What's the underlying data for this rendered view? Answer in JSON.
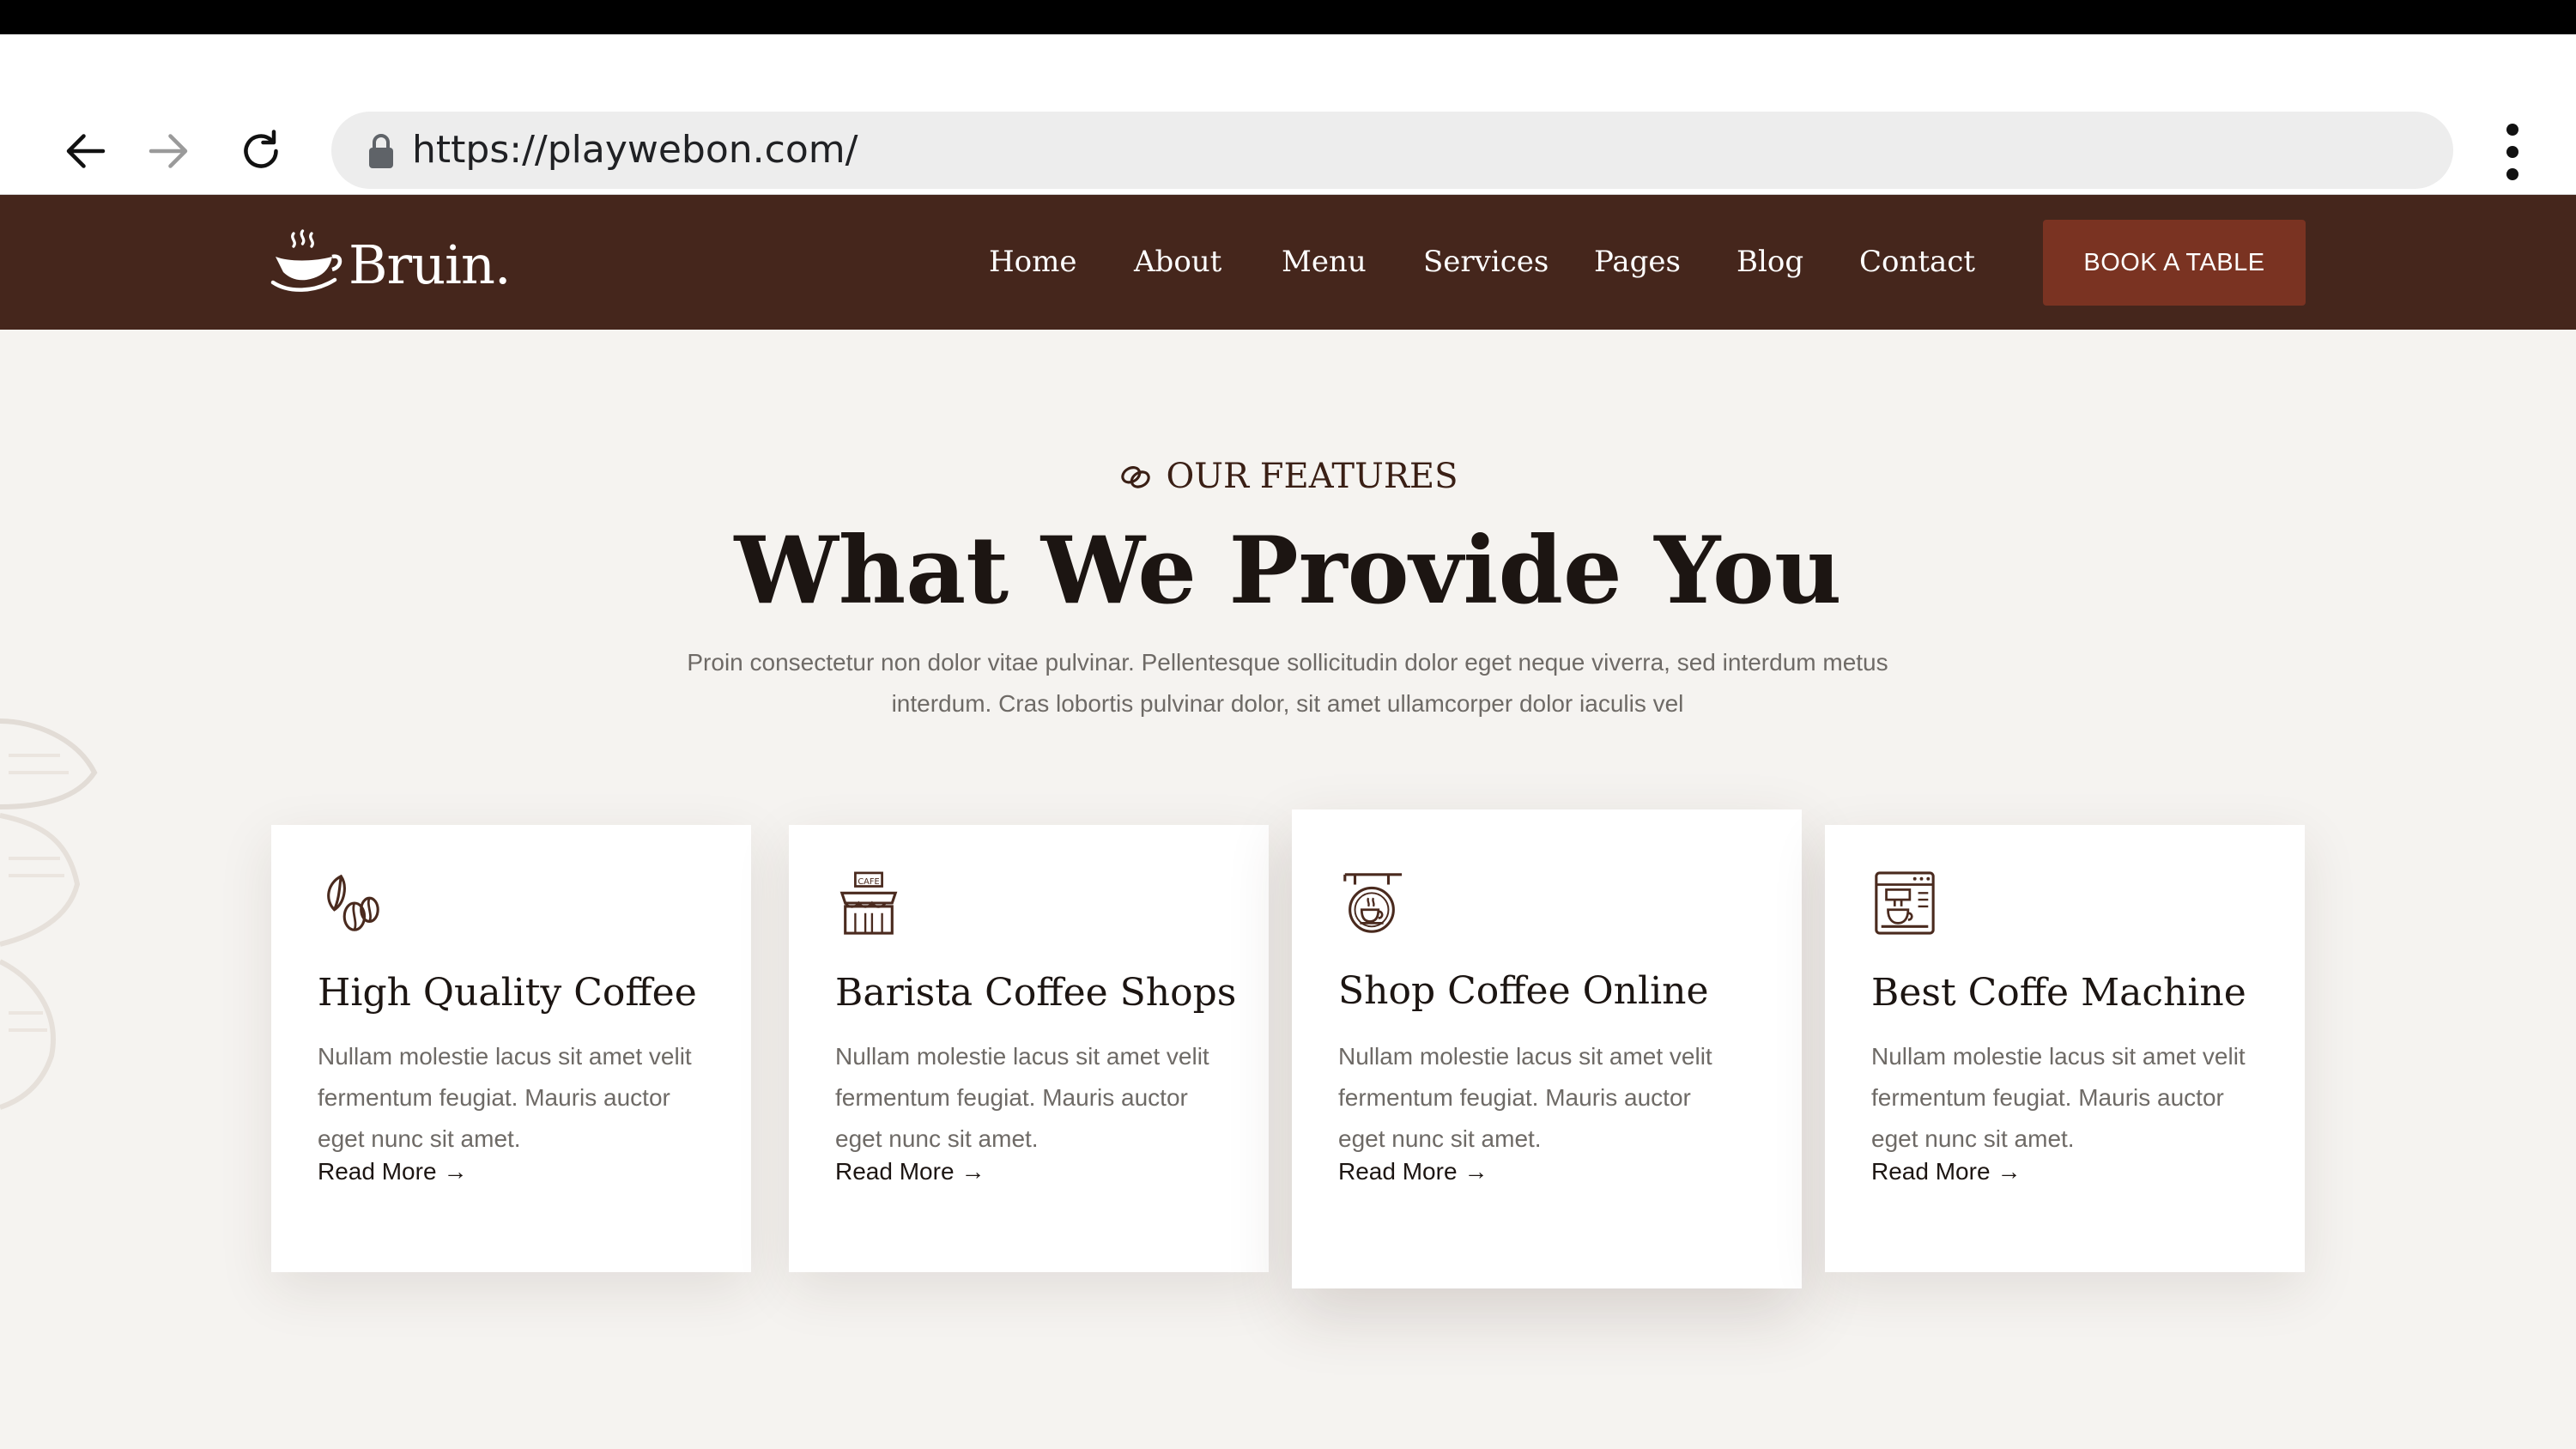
{
  "browser": {
    "url": "https://playwebon.com/",
    "icons": [
      "back-arrow-icon",
      "forward-arrow-icon",
      "reload-icon",
      "lock-icon",
      "more-vert-icon"
    ]
  },
  "header": {
    "logo_text": "Bruin.",
    "nav": [
      "Home",
      "About",
      "Menu",
      "Services",
      "Pages",
      "Blog",
      "Contact"
    ],
    "cta_label": "BOOK A TABLE",
    "colors": {
      "header_bg": "#45261c",
      "cta_bg": "#7a3322"
    }
  },
  "features": {
    "eyebrow": "OUR FEATURES",
    "title": "What We Provide You",
    "description": "Proin consectetur non dolor vitae pulvinar. Pellentesque sollicitudin dolor eget neque viverra, sed interdum metus interdum. Cras lobortis pulvinar dolor, sit amet ullamcorper dolor iaculis vel",
    "cards": [
      {
        "icon": "coffee-beans-icon",
        "title": "High Quality Coffee",
        "text": "Nullam molestie lacus sit amet velit fermentum feugiat. Mauris auctor eget nunc sit amet.",
        "link": "Read More"
      },
      {
        "icon": "cafe-shop-icon",
        "title": "Barista Coffee Shops",
        "text": "Nullam molestie lacus sit amet velit fermentum feugiat. Mauris auctor eget nunc sit amet.",
        "link": "Read More"
      },
      {
        "icon": "coffee-sign-icon",
        "title": "Shop Coffee Online",
        "text": "Nullam molestie lacus sit amet velit fermentum feugiat. Mauris auctor eget nunc sit amet.",
        "link": "Read More"
      },
      {
        "icon": "coffee-machine-icon",
        "title": "Best Coffe Machine",
        "text": "Nullam molestie lacus sit amet velit fermentum feugiat. Mauris auctor eget nunc sit amet.",
        "link": "Read More"
      }
    ]
  }
}
